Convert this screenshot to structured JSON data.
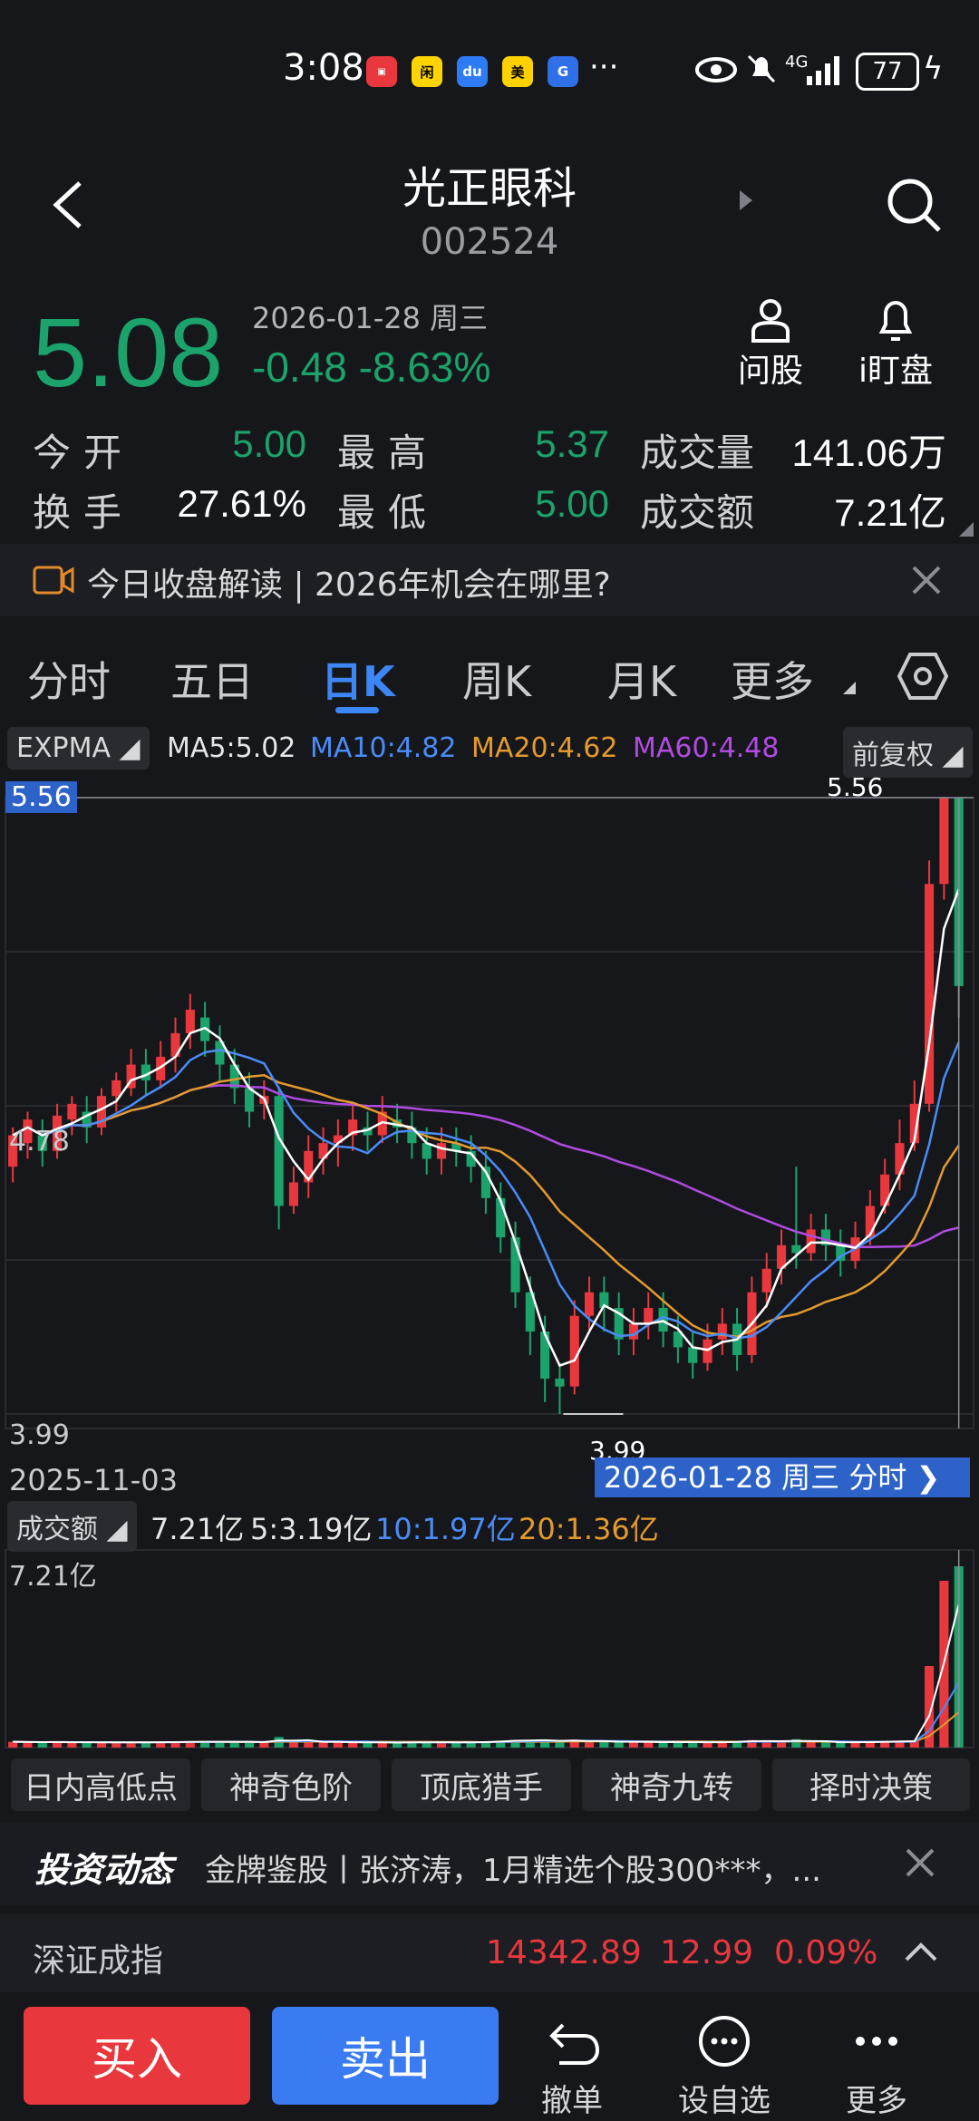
{
  "status_bar": {
    "time": "3:08",
    "app_icons": [
      "huawei-appgallery",
      "xianyu",
      "baidu",
      "meituan",
      "tonghuashun"
    ],
    "more": "···",
    "network": "4G",
    "battery": "77"
  },
  "header": {
    "title": "光正眼科",
    "code": "002524"
  },
  "quote": {
    "price": "5.08",
    "date": "2026-01-28 周三",
    "change": "-0.48",
    "change_pct": "-8.63%",
    "color": "#1ba36b"
  },
  "quick_actions": {
    "ask": "问股",
    "watch": "i盯盘"
  },
  "stats": [
    {
      "label": "今开",
      "value": "5.00"
    },
    {
      "label": "最高",
      "value": "5.37"
    },
    {
      "label": "成交量",
      "value": "141.06万"
    },
    {
      "label": "换手",
      "value": "27.61%"
    },
    {
      "label": "最低",
      "value": "5.00"
    },
    {
      "label": "成交额",
      "value": "7.21亿"
    }
  ],
  "banner": {
    "text": "今日收盘解读 | 2026年机会在哪里?"
  },
  "tabs": [
    "分时",
    "五日",
    "日K",
    "周K",
    "月K",
    "更多"
  ],
  "active_tab": "日K",
  "indicators": {
    "main": "EXPMA",
    "ma5": "MA5:5.02",
    "ma10": "MA10:4.82",
    "ma20": "MA20:4.62",
    "ma60": "MA60:4.48",
    "adjust": "前复权"
  },
  "chart_data": {
    "type": "candlestick",
    "y_labels": {
      "top": "5.56",
      "mid": "4.78",
      "bottom": "3.99"
    },
    "high_marker": "5.56",
    "low_marker": "3.99",
    "start_date": "2025-11-03",
    "cursor_label": "2026-01-28 周三 分时",
    "ylim": [
      3.99,
      5.56
    ],
    "candles": [
      [
        4.62,
        4.7,
        4.58,
        4.72
      ],
      [
        4.68,
        4.74,
        4.64,
        4.76
      ],
      [
        4.7,
        4.66,
        4.62,
        4.74
      ],
      [
        4.66,
        4.75,
        4.64,
        4.78
      ],
      [
        4.74,
        4.78,
        4.7,
        4.8
      ],
      [
        4.76,
        4.72,
        4.68,
        4.8
      ],
      [
        4.72,
        4.8,
        4.7,
        4.82
      ],
      [
        4.8,
        4.84,
        4.76,
        4.86
      ],
      [
        4.82,
        4.88,
        4.8,
        4.92
      ],
      [
        4.88,
        4.84,
        4.8,
        4.92
      ],
      [
        4.84,
        4.9,
        4.82,
        4.94
      ],
      [
        4.9,
        4.96,
        4.86,
        5.0
      ],
      [
        4.96,
        5.02,
        4.92,
        5.06
      ],
      [
        5.0,
        4.94,
        4.9,
        5.04
      ],
      [
        4.94,
        4.88,
        4.84,
        4.98
      ],
      [
        4.88,
        4.82,
        4.78,
        4.92
      ],
      [
        4.82,
        4.76,
        4.72,
        4.86
      ],
      [
        4.78,
        4.8,
        4.74,
        4.84
      ],
      [
        4.8,
        4.52,
        4.46,
        4.82
      ],
      [
        4.52,
        4.58,
        4.5,
        4.62
      ],
      [
        4.58,
        4.66,
        4.54,
        4.7
      ],
      [
        4.64,
        4.68,
        4.6,
        4.72
      ],
      [
        4.68,
        4.7,
        4.62,
        4.74
      ],
      [
        4.7,
        4.74,
        4.66,
        4.78
      ],
      [
        4.72,
        4.7,
        4.66,
        4.76
      ],
      [
        4.7,
        4.76,
        4.68,
        4.8
      ],
      [
        4.74,
        4.72,
        4.68,
        4.78
      ],
      [
        4.72,
        4.68,
        4.64,
        4.76
      ],
      [
        4.68,
        4.64,
        4.6,
        4.72
      ],
      [
        4.64,
        4.68,
        4.6,
        4.72
      ],
      [
        4.68,
        4.66,
        4.62,
        4.72
      ],
      [
        4.66,
        4.62,
        4.58,
        4.7
      ],
      [
        4.62,
        4.54,
        4.5,
        4.66
      ],
      [
        4.54,
        4.44,
        4.4,
        4.58
      ],
      [
        4.44,
        4.3,
        4.26,
        4.48
      ],
      [
        4.3,
        4.2,
        4.14,
        4.34
      ],
      [
        4.2,
        4.08,
        4.02,
        4.24
      ],
      [
        4.08,
        4.06,
        3.99,
        4.12
      ],
      [
        4.06,
        4.24,
        4.04,
        4.28
      ],
      [
        4.24,
        4.3,
        4.2,
        4.34
      ],
      [
        4.3,
        4.26,
        4.2,
        4.34
      ],
      [
        4.26,
        4.18,
        4.14,
        4.3
      ],
      [
        4.18,
        4.22,
        4.14,
        4.26
      ],
      [
        4.22,
        4.26,
        4.18,
        4.3
      ],
      [
        4.26,
        4.2,
        4.16,
        4.3
      ],
      [
        4.2,
        4.16,
        4.12,
        4.24
      ],
      [
        4.16,
        4.12,
        4.08,
        4.2
      ],
      [
        4.12,
        4.18,
        4.1,
        4.22
      ],
      [
        4.18,
        4.22,
        4.14,
        4.26
      ],
      [
        4.22,
        4.14,
        4.1,
        4.26
      ],
      [
        4.14,
        4.3,
        4.12,
        4.34
      ],
      [
        4.3,
        4.36,
        4.26,
        4.4
      ],
      [
        4.36,
        4.42,
        4.32,
        4.46
      ],
      [
        4.42,
        4.4,
        4.36,
        4.62
      ],
      [
        4.4,
        4.46,
        4.38,
        4.5
      ],
      [
        4.46,
        4.42,
        4.38,
        4.5
      ],
      [
        4.42,
        4.38,
        4.34,
        4.46
      ],
      [
        4.38,
        4.44,
        4.36,
        4.48
      ],
      [
        4.44,
        4.52,
        4.42,
        4.56
      ],
      [
        4.52,
        4.6,
        4.5,
        4.64
      ],
      [
        4.6,
        4.68,
        4.56,
        4.74
      ],
      [
        4.68,
        4.78,
        4.66,
        4.84
      ],
      [
        4.78,
        5.34,
        4.76,
        5.4
      ],
      [
        5.34,
        5.56,
        5.3,
        5.56
      ],
      [
        5.56,
        5.08,
        5.0,
        5.37
      ]
    ]
  },
  "volume": {
    "label": "成交额",
    "value": "7.21亿",
    "ma5": "5:3.19亿",
    "ma10": "10:1.97亿",
    "ma20": "20:1.36亿",
    "axis_top": "7.21亿"
  },
  "functions": [
    "日内高低点",
    "神奇色阶",
    "顶底猎手",
    "神奇九转",
    "择时决策"
  ],
  "news": {
    "brand": "投资动态",
    "text": "金牌鉴股丨张济涛，1月精选个股300***，..."
  },
  "index": {
    "name": "深证成指",
    "value": "14342.89",
    "change": "12.99",
    "pct": "0.09%"
  },
  "bottom_bar": {
    "buy": "买入",
    "sell": "卖出",
    "cancel": "撤单",
    "watchlist": "设自选",
    "more": "更多"
  },
  "colors": {
    "up": "#e8383d",
    "down": "#1ba36b",
    "ma5": "#ffffff",
    "ma10": "#4a8cf7",
    "ma20": "#e39a2d",
    "ma60": "#b04be0"
  }
}
